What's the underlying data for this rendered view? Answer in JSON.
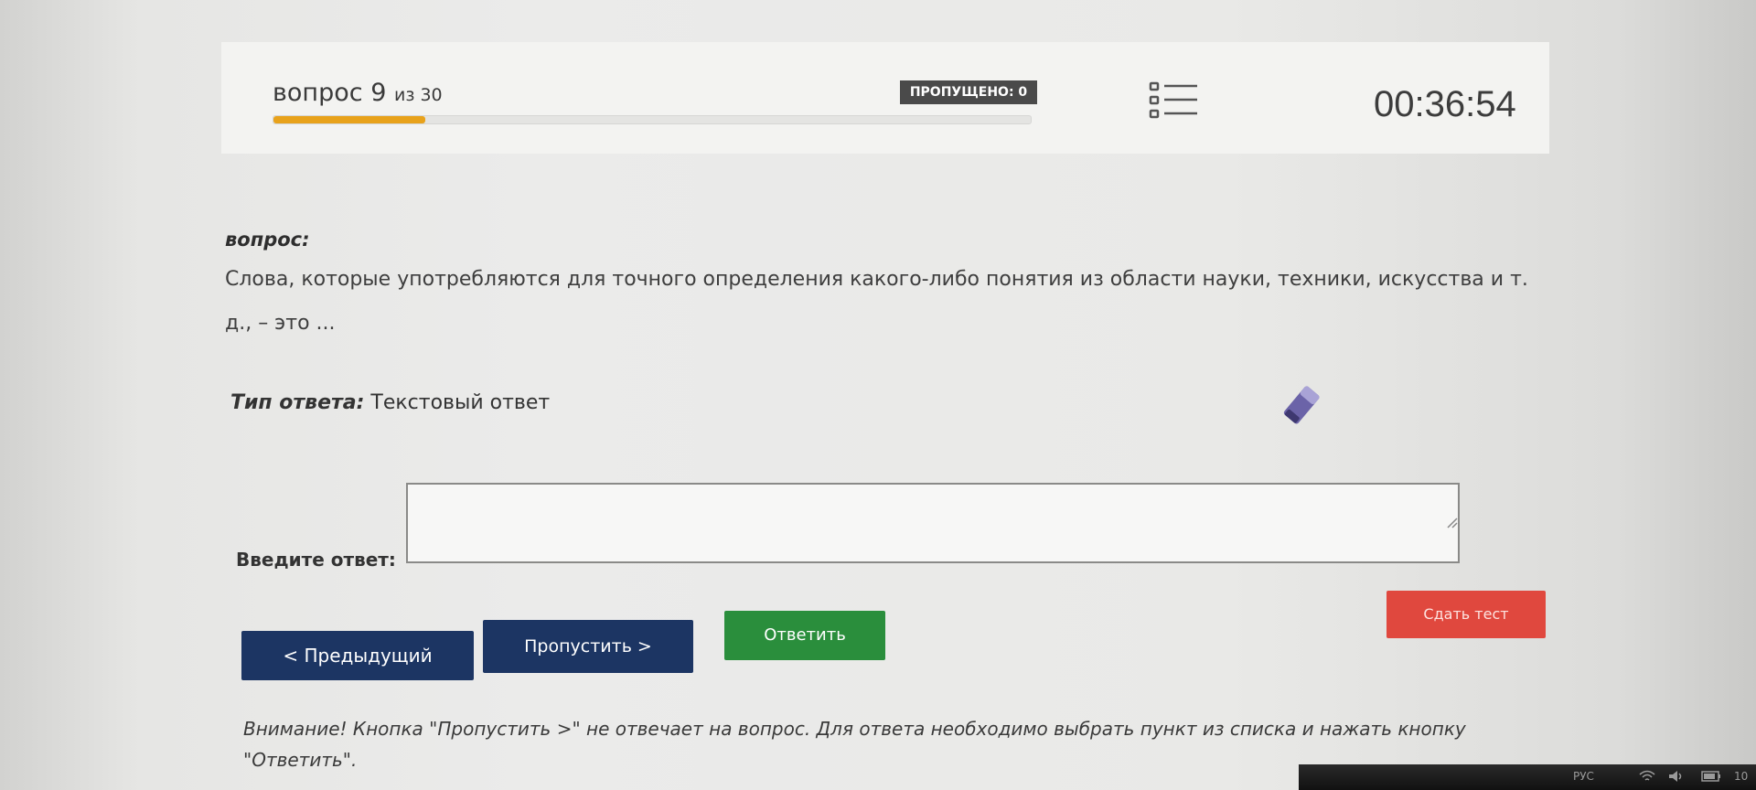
{
  "header": {
    "question_word": "вопрос",
    "question_number": "9",
    "question_of": "из 30",
    "progress_fraction": 0.2,
    "skipped_label": "ПРОПУЩЕНО: 0",
    "timer": "00:36:54",
    "list_icon": "list-icon"
  },
  "question": {
    "label": "вопрос:",
    "text": "Слова, которые употребляются для точного определения какого-либо понятия из области науки, техники, искусства и т. д., – это ..."
  },
  "answer_type": {
    "label": "Тип ответа:",
    "value": "Текстовый ответ"
  },
  "answer_input": {
    "label": "Введите ответ:",
    "value": ""
  },
  "buttons": {
    "prev": "< Предыдущий",
    "skip": "Пропустить >",
    "answer": "Ответить",
    "submit": "Сдать тест"
  },
  "notice": "Внимание! Кнопка \"Пропустить >\" не отвечает на вопрос. Для ответа необходимо выбрать пункт из списка и нажать кнопку \"Ответить\".",
  "taskbar": {
    "lang": "РУС",
    "clock": "10"
  },
  "colors": {
    "progress": "#e8a21b",
    "nav_button": "#1c3563",
    "answer_button": "#2a8e3c",
    "submit_button": "#e0483e"
  }
}
